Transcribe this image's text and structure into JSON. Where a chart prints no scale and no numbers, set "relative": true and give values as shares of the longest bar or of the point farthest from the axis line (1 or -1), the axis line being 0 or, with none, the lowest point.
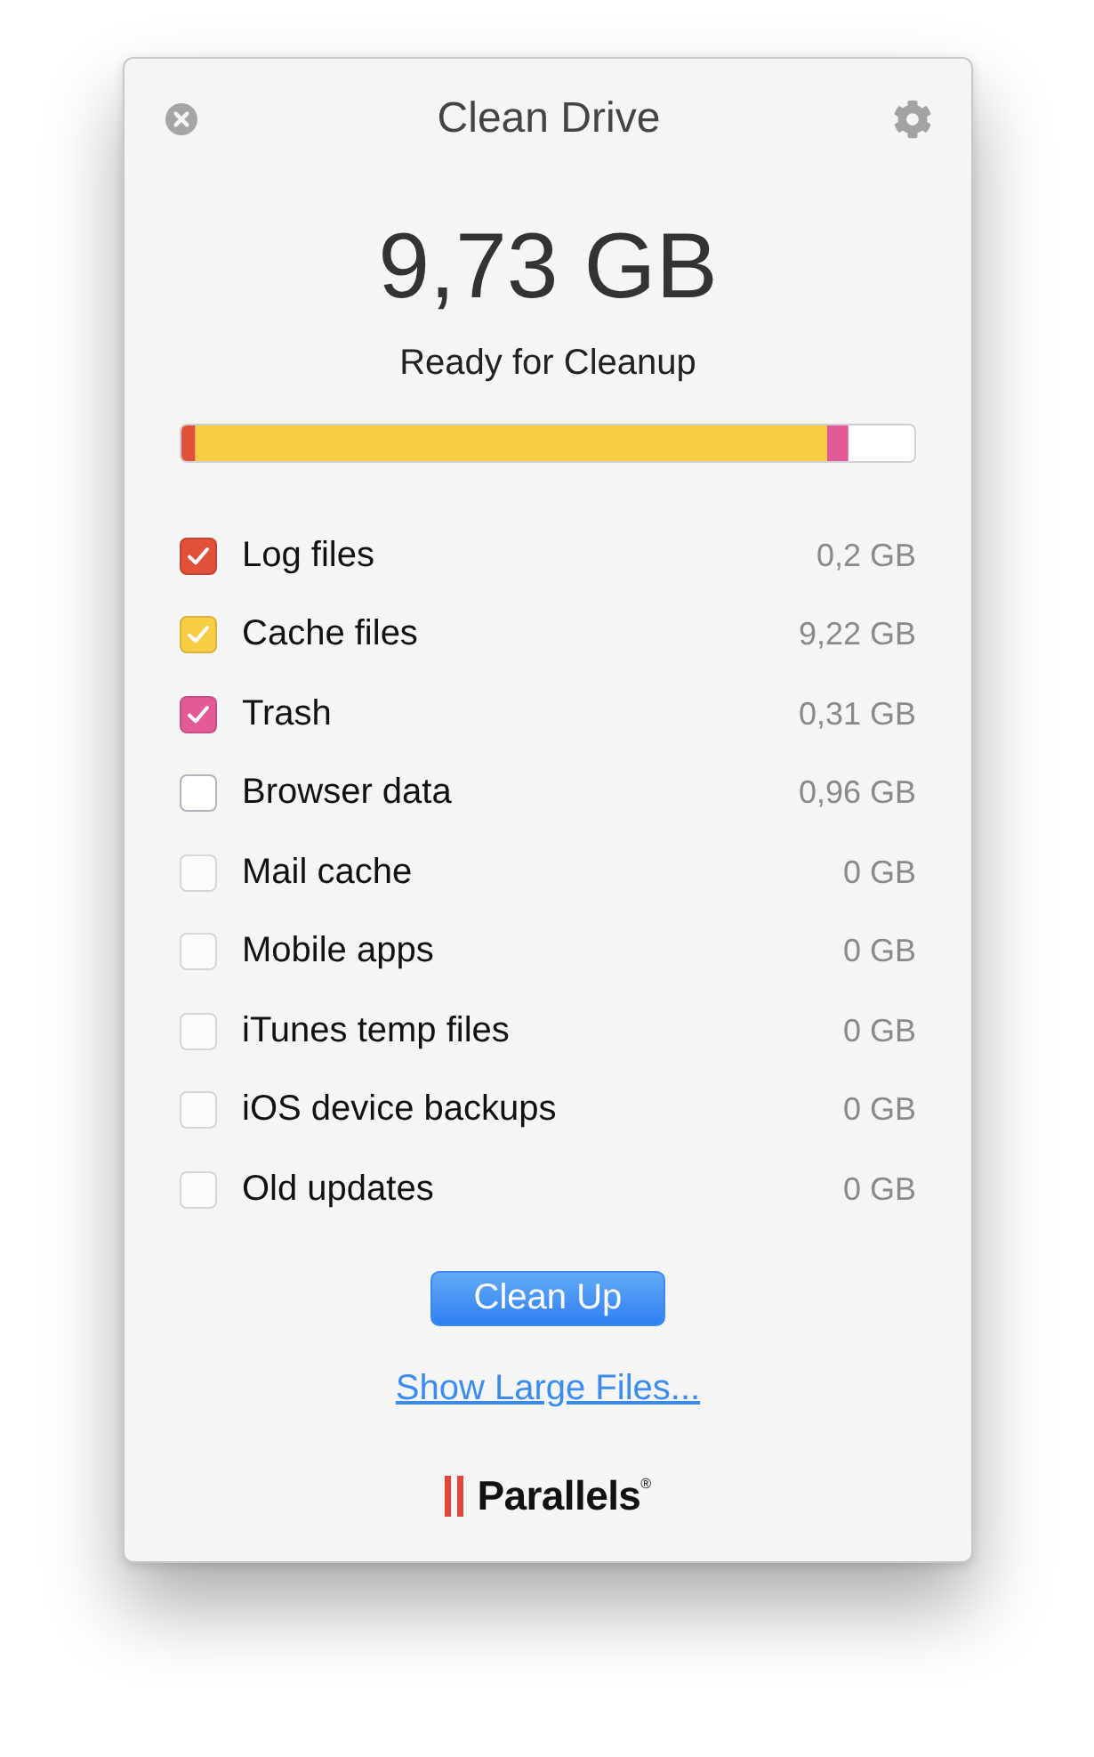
{
  "window": {
    "title": "Clean Drive"
  },
  "summary": {
    "total": "9,73 GB",
    "status": "Ready for Cleanup"
  },
  "cleanup_bar": {
    "chart_data": {
      "type": "bar",
      "orientation": "horizontal",
      "stacked": true,
      "relative": true,
      "series": [
        {
          "color": "#e0503a",
          "values": [
            0.019
          ]
        },
        {
          "color": "#f7cd46",
          "values": [
            0.862
          ]
        },
        {
          "color": "#e35a98",
          "values": [
            0.029
          ]
        },
        {
          "color": "#ffffff",
          "values": [
            0.09
          ]
        }
      ]
    }
  },
  "items": [
    {
      "label": "Log files",
      "size": "0,2 GB",
      "checked": true,
      "disabled": false,
      "color": "#e0503a"
    },
    {
      "label": "Cache files",
      "size": "9,22 GB",
      "checked": true,
      "disabled": false,
      "color": "#f7cd46"
    },
    {
      "label": "Trash",
      "size": "0,31 GB",
      "checked": true,
      "disabled": false,
      "color": "#e35a98"
    },
    {
      "label": "Browser data",
      "size": "0,96 GB",
      "checked": false,
      "disabled": false
    },
    {
      "label": "Mail cache",
      "size": "0 GB",
      "checked": false,
      "disabled": true
    },
    {
      "label": "Mobile apps",
      "size": "0 GB",
      "checked": false,
      "disabled": true
    },
    {
      "label": "iTunes temp files",
      "size": "0 GB",
      "checked": false,
      "disabled": true
    },
    {
      "label": "iOS device backups",
      "size": "0 GB",
      "checked": false,
      "disabled": true
    },
    {
      "label": "Old updates",
      "size": "0 GB",
      "checked": false,
      "disabled": true
    }
  ],
  "buttons": {
    "clean_up": "Clean Up"
  },
  "links": {
    "show_large_files": "Show Large Files..."
  },
  "logo": {
    "text": "Parallels$^{®}$"
  }
}
